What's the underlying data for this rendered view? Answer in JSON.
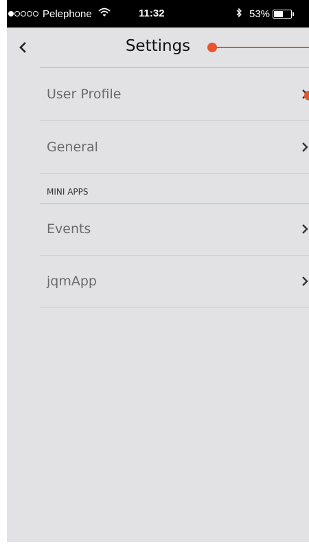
{
  "status_bar": {
    "carrier": "Pelephone",
    "time": "11:32",
    "battery_text": "53%",
    "battery_level": 0.53,
    "signal_filled": 1,
    "signal_total": 5
  },
  "nav": {
    "title": "Settings",
    "back_icon": "chevron-left-icon"
  },
  "rows": [
    {
      "label": "User Profile",
      "icon": "chevron-right-icon"
    },
    {
      "label": "General",
      "icon": "chevron-right-icon"
    }
  ],
  "section": {
    "label": "MINI APPS"
  },
  "mini_apps": [
    {
      "label": "Events",
      "icon": "chevron-right-icon"
    },
    {
      "label": "jqmApp",
      "icon": "chevron-right-icon"
    }
  ],
  "colors": {
    "background": "#e2e2e4",
    "annotation": "#e8552c",
    "divider_accent": "#8fc4dc"
  }
}
